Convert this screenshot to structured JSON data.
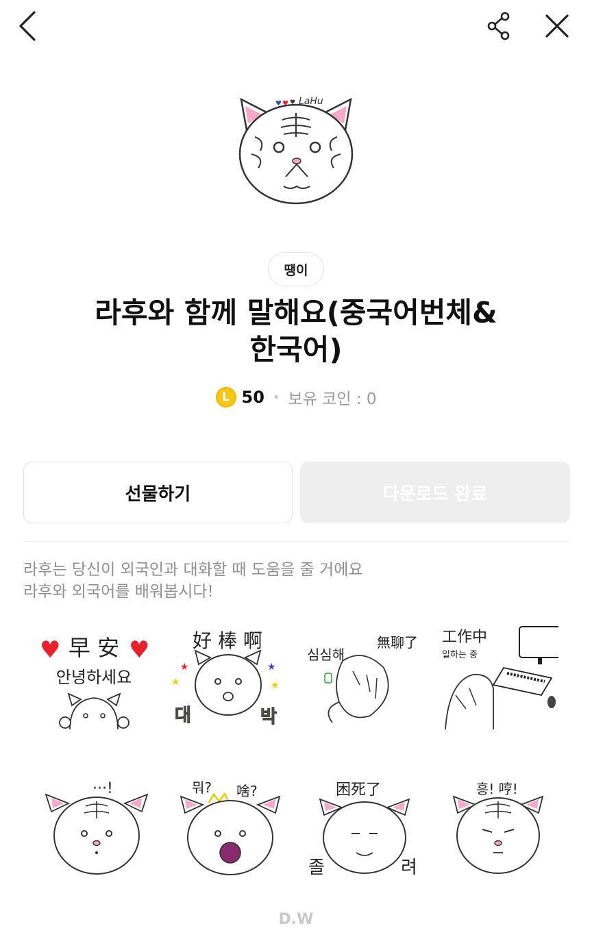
{
  "topbar": {
    "back_icon": "chevron-left-icon",
    "share_icon": "share-icon",
    "close_icon": "close-icon"
  },
  "hero": {
    "caption": "LaHu"
  },
  "author": "땡이",
  "title": "라후와 함께 말해요(중국어번체&\n한국어)",
  "price": {
    "coin_symbol": "L",
    "amount": "50",
    "owned_label": "보유 코인 : 0"
  },
  "buttons": {
    "gift": "선물하기",
    "download": "다운로드 완료"
  },
  "description": [
    "라후는 당신이 외국인과 대화할 때 도움을 줄 거에요",
    "라후와 외국어를 배워봅시다!"
  ],
  "stickers": [
    {
      "top": "早 安",
      "bottom": "안녕하세요"
    },
    {
      "top": "好 棒 啊",
      "left": "대",
      "right": "박"
    },
    {
      "left": "심심해",
      "right": "無聊了"
    },
    {
      "top": "工作中",
      "sub": "일하는 중"
    },
    {
      "top": "···!"
    },
    {
      "left": "뭐?",
      "right": "啥?"
    },
    {
      "top": "困死了",
      "left": "졸",
      "right": "려"
    },
    {
      "top": "흥! 哼!"
    }
  ],
  "footer": "D.W",
  "colors": {
    "coin": "#f6c71a",
    "heart": "#e8202a",
    "blush": "#f5a8c8",
    "disabled_btn": "#eeeeee"
  }
}
